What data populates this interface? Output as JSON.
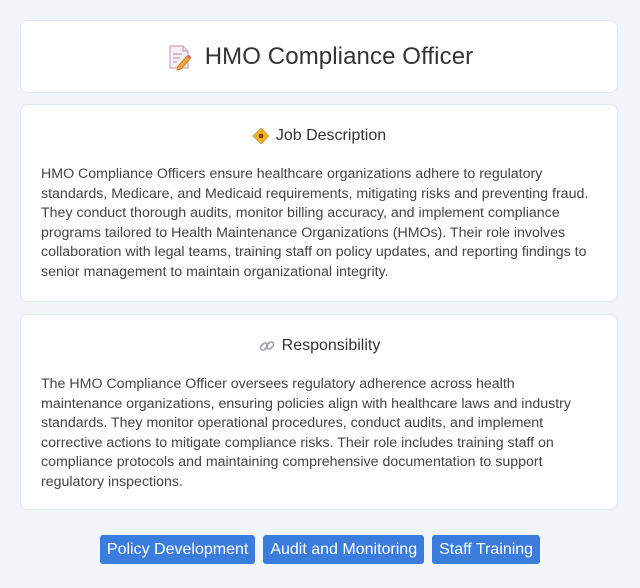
{
  "header": {
    "title": "HMO Compliance Officer",
    "icon": "document-pencil-icon"
  },
  "job_description": {
    "icon": "diamond-badge-icon",
    "heading": "Job Description",
    "text": "HMO Compliance Officers ensure healthcare organizations adhere to regulatory standards, Medicare, and Medicaid requirements, mitigating risks and preventing fraud. They conduct thorough audits, monitor billing accuracy, and implement compliance programs tailored to Health Maintenance Organizations (HMOs). Their role involves collaboration with legal teams, training staff on policy updates, and reporting findings to senior management to maintain organizational integrity."
  },
  "responsibility": {
    "icon": "link-icon",
    "heading": "Responsibility",
    "text": "The HMO Compliance Officer oversees regulatory adherence across health maintenance organizations, ensuring policies align with healthcare laws and industry standards. They monitor operational procedures, conduct audits, and implement corrective actions to mitigate compliance risks. Their role includes training staff on compliance protocols and maintaining comprehensive documentation to support regulatory inspections."
  },
  "tags": [
    {
      "label": "Policy Development"
    },
    {
      "label": "Audit and Monitoring"
    },
    {
      "label": "Staff Training"
    }
  ],
  "colors": {
    "tag_background": "#3b7ddd",
    "page_background": "#f1f5f9"
  }
}
